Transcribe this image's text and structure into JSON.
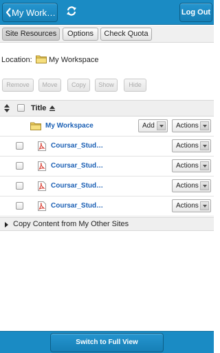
{
  "header": {
    "back_label": "My Work…",
    "logout_label": "Log Out"
  },
  "tabs": [
    {
      "label": "Site Resources",
      "active": true
    },
    {
      "label": "Options",
      "active": false
    },
    {
      "label": "Check Quota",
      "active": false
    }
  ],
  "location": {
    "label": "Location:",
    "value": "My Workspace"
  },
  "toolbar": {
    "remove": "Remove",
    "move": "Move",
    "copy": "Copy",
    "show": "Show",
    "hide": "Hide"
  },
  "table": {
    "title_header": "Title",
    "folder_row": {
      "name": "My Workspace",
      "add_label": "Add",
      "actions_label": "Actions"
    },
    "files": [
      {
        "name": "Coursar_Stud…",
        "actions_label": "Actions"
      },
      {
        "name": "Coursar_Stud…",
        "actions_label": "Actions"
      },
      {
        "name": "Coursar_Stud…",
        "actions_label": "Actions"
      },
      {
        "name": "Coursar_Stud…",
        "actions_label": "Actions"
      }
    ],
    "copy_content_label": "Copy Content from My Other Sites"
  },
  "footer": {
    "full_view_label": "Switch to Full View"
  },
  "colors": {
    "header_bg": "#1a8bc4",
    "link": "#1a5fb4",
    "folder": "#f0d060",
    "pdf_red": "#d83a2e"
  },
  "icons": [
    "chevron-left-icon",
    "sync-icon",
    "folder-icon",
    "pdf-icon",
    "sort-icon",
    "dropdown-arrow-icon",
    "expand-triangle-icon"
  ]
}
